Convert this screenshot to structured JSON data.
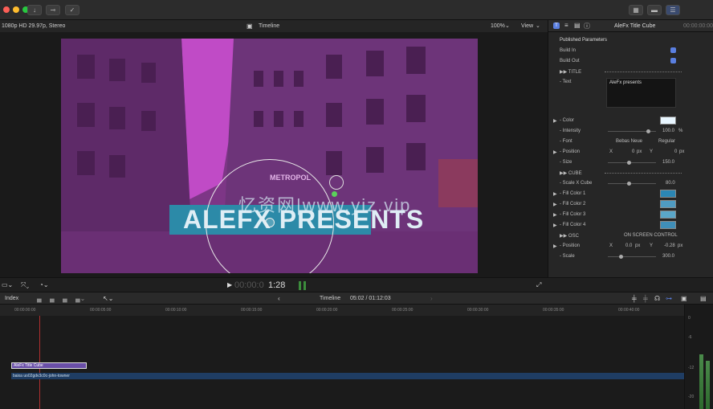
{
  "viewer": {
    "format": "1080p HD 29.97p, Stereo",
    "title": "Timeline",
    "zoom": "100%",
    "view_label": "View",
    "title_overlay": "ALEFX PRESENTS",
    "sign_text": "METROPOL",
    "watermark": "忆资网|www.yiz.vip",
    "timecode_prefix": "00:00:0",
    "timecode_main": "1:28"
  },
  "inspector": {
    "title": "AleFx Title Cube",
    "timecode": "00:00:00:00",
    "section": "Published Parameters",
    "build_in": "Build In",
    "build_out": "Build Out",
    "title_group": "▶▶ TITLE",
    "text_label": "- Text",
    "text_value": "AleFx presents",
    "color_label": "- Color",
    "intensity_label": "- Intensity",
    "intensity_value": "100.0",
    "intensity_unit": "%",
    "font_label": "- Font",
    "font_name": "Bebas Neue",
    "font_style": "Regular",
    "position_label": "- Position",
    "pos_x_label": "X",
    "pos_x_value": "0",
    "pos_y_label": "Y",
    "pos_y_value": "0",
    "px_unit": "px",
    "size_label": "- Size",
    "size_value": "150.0",
    "cube_group": "▶▶ CUBE",
    "scale_x_label": "- Scale X Cube",
    "scale_x_value": "80.0",
    "fill1": "- Fill Color 1",
    "fill2": "- Fill Color 2",
    "fill3": "- Fill Color 3",
    "fill4": "- Fill Color 4",
    "osc_group": "▶▶ OSC",
    "osc_value": "ON SCREEN CONTROL",
    "position2_label": "- Position",
    "pos2_x_value": "0.0",
    "pos2_y_value": "-0.28",
    "scale_label": "- Scale",
    "scale_value": "300.0"
  },
  "timeline": {
    "index_label": "Index",
    "name": "Timeline",
    "duration": "05:02 / 01:12:03",
    "ticks": [
      "00:00:00:00",
      "00:00:05:00",
      "00:00:10:00",
      "00:00:15:00",
      "00:00:20:00",
      "00:00:25:00",
      "00:00:30:00",
      "00:00:35:00",
      "00:00:40:00"
    ],
    "title_clip": "AleFx Title Cube",
    "video_clip": "baixa uo02gdv3c0c-john-towner",
    "meter_labels": [
      "0",
      "-6",
      "-12",
      "-20"
    ]
  },
  "colors": {
    "accent": "#5a7fe0",
    "title_bar": "#2c8aa8",
    "title_clip": "#6a4fa8",
    "video_clip": "#1f3d63"
  }
}
